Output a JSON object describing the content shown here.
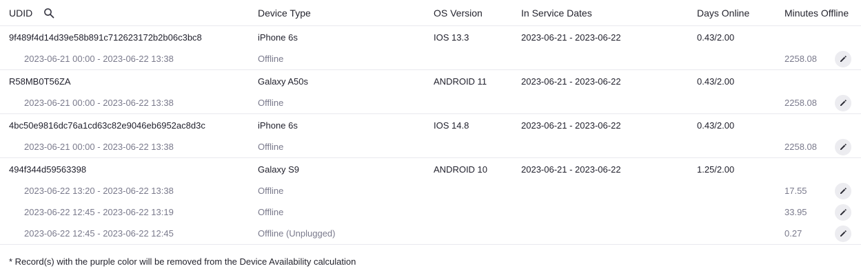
{
  "headers": {
    "udid": "UDID",
    "device_type": "Device Type",
    "os_version": "OS Version",
    "service_dates": "In Service Dates",
    "days_online": "Days Online",
    "minutes_offline": "Minutes Offline",
    "search_icon": "search-icon"
  },
  "devices": [
    {
      "udid": "9f489f4d14d39e58b891c712623172b2b06c3bc8",
      "device_type": "iPhone 6s",
      "os_version": "IOS 13.3",
      "service_dates": "2023-06-21 - 2023-06-22",
      "days_online": "0.43/2.00",
      "records": [
        {
          "range": "2023-06-21 00:00 - 2023-06-22 13:38",
          "status": "Offline",
          "minutes": "2258.08"
        }
      ]
    },
    {
      "udid": "R58MB0T56ZA",
      "device_type": "Galaxy A50s",
      "os_version": "ANDROID 11",
      "service_dates": "2023-06-21 - 2023-06-22",
      "days_online": "0.43/2.00",
      "records": [
        {
          "range": "2023-06-21 00:00 - 2023-06-22 13:38",
          "status": "Offline",
          "minutes": "2258.08"
        }
      ]
    },
    {
      "udid": "4bc50e9816dc76a1cd63c82e9046eb6952ac8d3c",
      "device_type": "iPhone 6s",
      "os_version": "IOS 14.8",
      "service_dates": "2023-06-21 - 2023-06-22",
      "days_online": "0.43/2.00",
      "records": [
        {
          "range": "2023-06-21 00:00 - 2023-06-22 13:38",
          "status": "Offline",
          "minutes": "2258.08"
        }
      ]
    },
    {
      "udid": "494f344d59563398",
      "device_type": "Galaxy S9",
      "os_version": "ANDROID 10",
      "service_dates": "2023-06-21 - 2023-06-22",
      "days_online": "1.25/2.00",
      "records": [
        {
          "range": "2023-06-22 13:20 - 2023-06-22 13:38",
          "status": "Offline",
          "minutes": "17.55"
        },
        {
          "range": "2023-06-22 12:45 - 2023-06-22 13:19",
          "status": "Offline",
          "minutes": "33.95"
        },
        {
          "range": "2023-06-22 12:45 - 2023-06-22 12:45",
          "status": "Offline (Unplugged)",
          "minutes": "0.27"
        }
      ]
    }
  ],
  "edit_icon": "pencil-icon",
  "footnote": "* Record(s) with the purple color will be removed from the Device Availability calculation",
  "colors": {
    "text": "#1f1f2b",
    "muted": "#7a7a8c",
    "divider": "#e9e9ee",
    "edit_bg": "#ececf0"
  }
}
